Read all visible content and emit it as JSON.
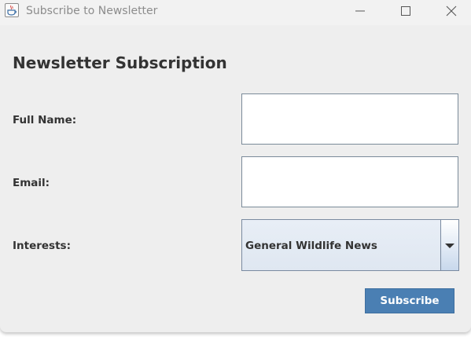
{
  "window": {
    "title": "Subscribe to Newsletter",
    "icon": "java-app-icon",
    "controls": {
      "minimize_icon": "minimize-icon",
      "maximize_icon": "maximize-icon",
      "close_icon": "close-icon"
    }
  },
  "form": {
    "heading": "Newsletter Subscription",
    "full_name": {
      "label": "Full Name:",
      "value": ""
    },
    "email": {
      "label": "Email:",
      "value": ""
    },
    "interests": {
      "label": "Interests:",
      "selected": "General Wildlife News",
      "arrow_icon": "chevron-down-icon"
    },
    "submit_label": "Subscribe"
  },
  "colors": {
    "background": "#eeeeee",
    "accent": "#4a7fb3",
    "text": "#333333"
  }
}
